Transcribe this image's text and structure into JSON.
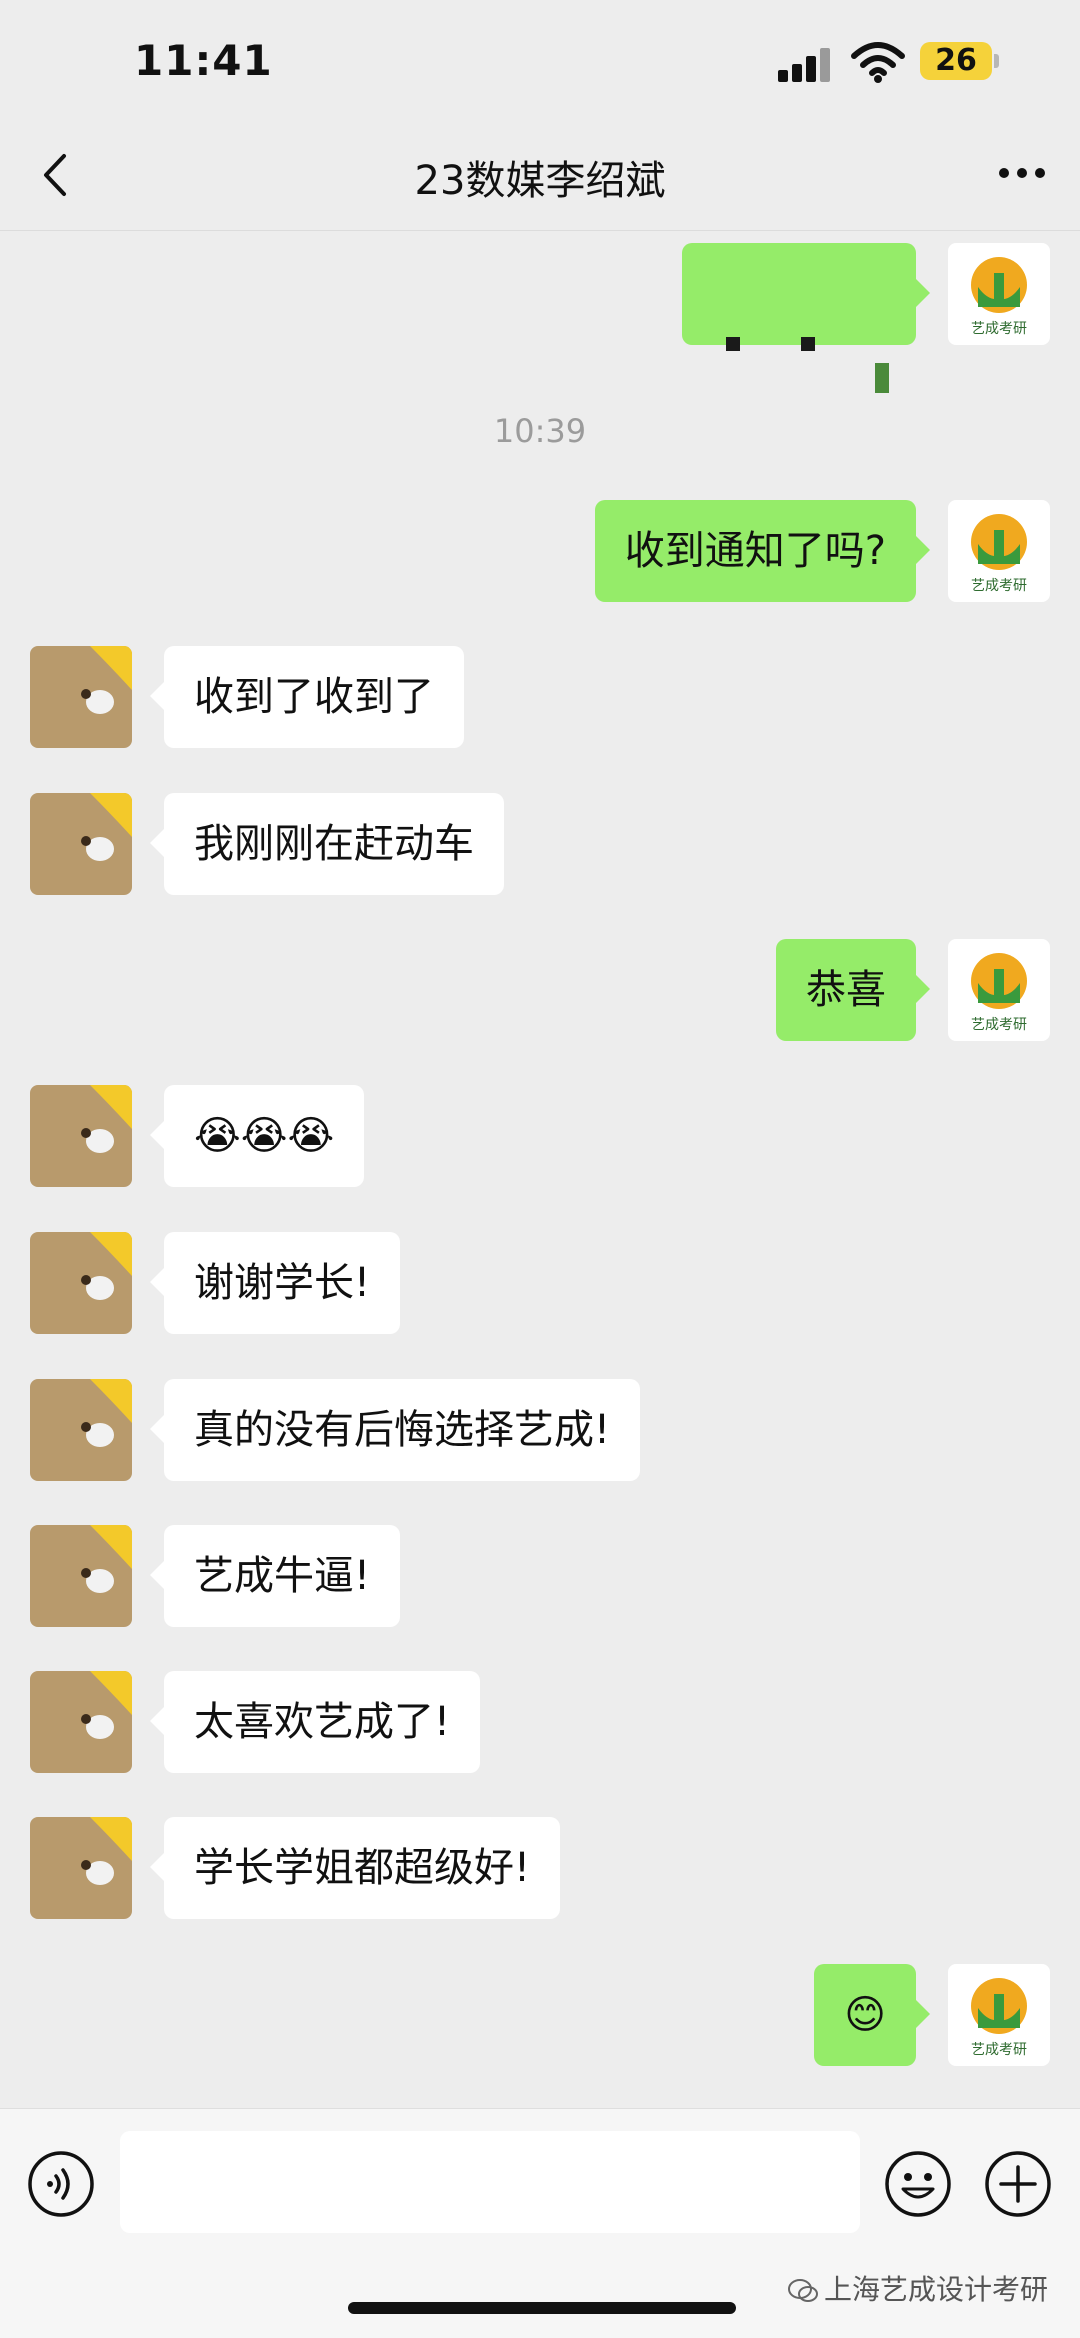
{
  "status_bar": {
    "time": "11:41",
    "battery": "26"
  },
  "header": {
    "title": "23数媒李绍斌"
  },
  "timestamp": "10:39",
  "messages": [
    {
      "from": "me",
      "text": ""
    },
    {
      "from": "me",
      "text": "收到通知了吗?"
    },
    {
      "from": "contact",
      "text": "收到了收到了"
    },
    {
      "from": "contact",
      "text": "我刚刚在赶动车"
    },
    {
      "from": "me",
      "text": "恭喜"
    },
    {
      "from": "contact",
      "text": "😭😭😭"
    },
    {
      "from": "contact",
      "text": "谢谢学长!"
    },
    {
      "from": "contact",
      "text": "真的没有后悔选择艺成!"
    },
    {
      "from": "contact",
      "text": "艺成牛逼!"
    },
    {
      "from": "contact",
      "text": "太喜欢艺成了!"
    },
    {
      "from": "contact",
      "text": "学长学姐都超级好!"
    },
    {
      "from": "me",
      "text": "😊"
    }
  ],
  "my_avatar": {
    "caption": "艺成考研"
  },
  "watermark": "上海艺成设计考研",
  "colors": {
    "background": "#ededed",
    "outgoing_bubble": "#95ec69",
    "incoming_bubble": "#ffffff",
    "battery": "#f5d23a"
  }
}
